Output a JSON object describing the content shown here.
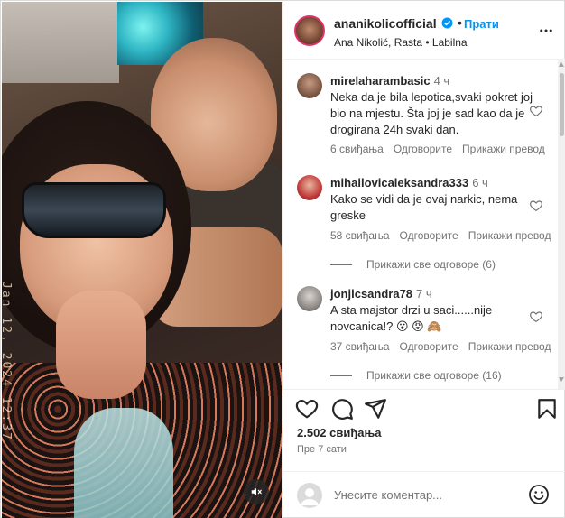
{
  "post": {
    "username": "ananikolicofficial",
    "follow_separator": "•",
    "follow_label": "Прати",
    "subtitle": "Ana Nikolić, Rasta • Labilna",
    "media_timestamp": "Jan 12, 2024 12:37",
    "verified_icon": "verified-badge-icon",
    "more_icon": "more-options-icon",
    "mute_icon": "audio-muted-icon"
  },
  "colors": {
    "accent": "#0095f6",
    "text": "#262626",
    "muted": "#737373",
    "border": "#efefef"
  },
  "comments": [
    {
      "username": "mirelaharambasic",
      "time": "4 ч",
      "text": "Neka da je bila lepotica,svaki pokret joj bio na mjestu. Šta joj je sad kao da je drogirana 24h svaki dan.",
      "likes": "6 свиђања",
      "reply_label": "Одговорите",
      "translate_label": "Прикажи превод",
      "replies_label": ""
    },
    {
      "username": "mihailovicaleksandra333",
      "time": "6 ч",
      "text": "Kako se vidi da je ovaj narkic, nema greske",
      "likes": "58 свиђања",
      "reply_label": "Одговорите",
      "translate_label": "Прикажи превод",
      "replies_label": "Прикажи све одговоре (6)"
    },
    {
      "username": "jonjicsandra78",
      "time": "7 ч",
      "text": "A sta majstor drzi u saci......nije novcanica!? 😮 😡 🙈",
      "likes": "37 свиђања",
      "reply_label": "Одговорите",
      "translate_label": "Прикажи превод",
      "replies_label": "Прикажи све одговоре (16)"
    }
  ],
  "actions": {
    "like_icon": "heart-icon",
    "comment_icon": "comment-icon",
    "share_icon": "share-icon",
    "save_icon": "bookmark-icon",
    "likes_count": "2.502 свиђања",
    "posted_time": "Пре 7 сати"
  },
  "add_comment": {
    "placeholder": "Унесите коментар...",
    "emoji_icon": "emoji-icon"
  }
}
